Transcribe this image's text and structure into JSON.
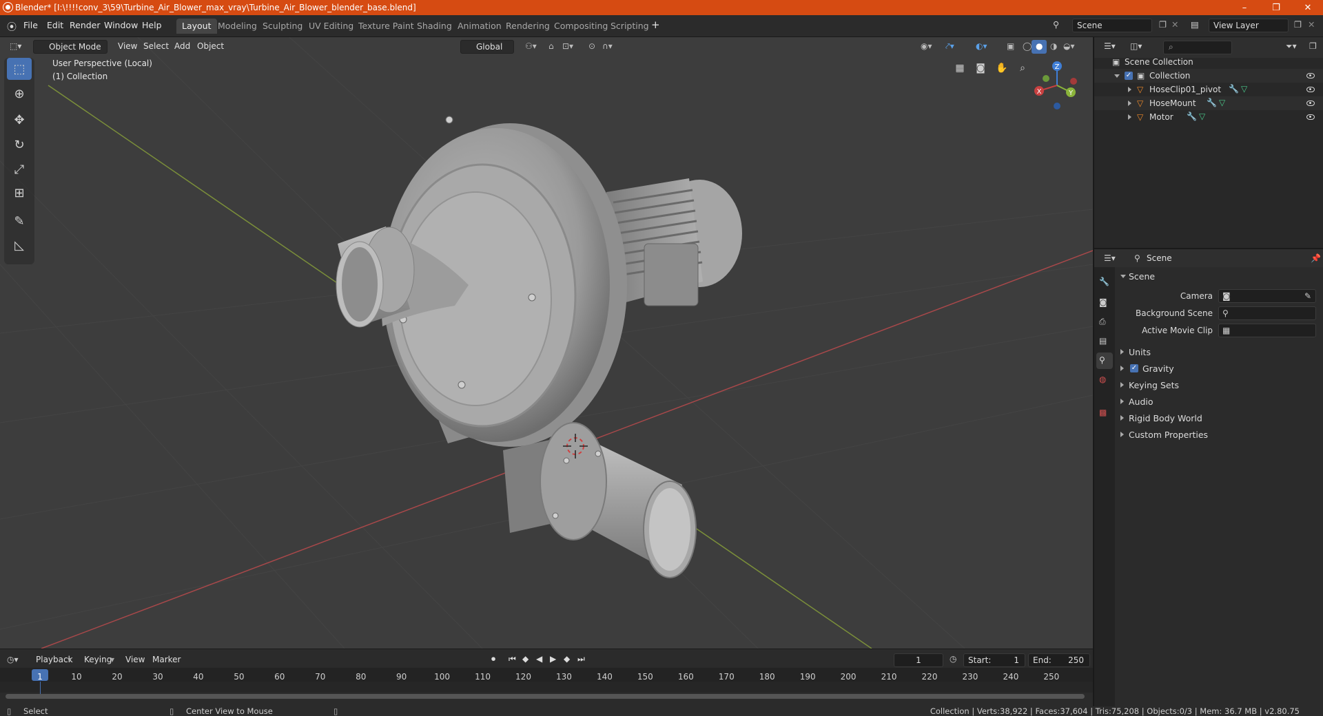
{
  "titlebar": {
    "title": "Blender* [I:\\!!!!conv_3\\59\\Turbine_Air_Blower_max_vray\\Turbine_Air_Blower_blender_base.blend]",
    "minimize": "–",
    "restore": "❐",
    "close": "✕"
  },
  "menu": {
    "file": "File",
    "edit": "Edit",
    "render": "Render",
    "window": "Window",
    "help": "Help"
  },
  "workspaces": [
    "Layout",
    "Modeling",
    "Sculpting",
    "UV Editing",
    "Texture Paint",
    "Shading",
    "Animation",
    "Rendering",
    "Compositing",
    "Scripting"
  ],
  "workspace_add": "+",
  "scene_selector": {
    "value": "Scene"
  },
  "view_layer_selector": {
    "value": "View Layer"
  },
  "viewport_header": {
    "mode": "Object Mode",
    "view": "View",
    "select": "Select",
    "add": "Add",
    "object": "Object",
    "orientation": "Global"
  },
  "viewport": {
    "perspective": "User Perspective (Local)",
    "collection": "(1) Collection",
    "gizmo": {
      "x": "X",
      "y": "Y",
      "z": "Z"
    }
  },
  "outliner": {
    "search_placeholder": "",
    "root": "Scene Collection",
    "collection": "Collection",
    "objects": [
      "HoseClip01_pivot",
      "HoseMount",
      "Motor"
    ]
  },
  "properties": {
    "header": "Scene",
    "panel_title": "Scene",
    "camera_label": "Camera",
    "background_scene_label": "Background Scene",
    "active_movie_clip_label": "Active Movie Clip",
    "panels": [
      "Units",
      "Gravity",
      "Keying Sets",
      "Audio",
      "Rigid Body World",
      "Custom Properties"
    ]
  },
  "timeline": {
    "playback": "Playback",
    "keying": "Keying",
    "view": "View",
    "marker": "Marker",
    "current_frame": "1",
    "start_label": "Start:",
    "start": "1",
    "end_label": "End:",
    "end": "250",
    "ruler": [
      "1",
      "10",
      "20",
      "30",
      "40",
      "50",
      "60",
      "70",
      "80",
      "90",
      "100",
      "110",
      "120",
      "130",
      "140",
      "150",
      "160",
      "170",
      "180",
      "190",
      "200",
      "210",
      "220",
      "230",
      "240",
      "250"
    ]
  },
  "statusbar": {
    "select": "Select",
    "center_view": "Center View to Mouse",
    "stats": "Collection | Verts:38,922 | Faces:37,604 | Tris:75,208 | Objects:0/3 | Mem: 36.7 MB | v2.80.75"
  },
  "colors": {
    "accent": "#4772b3",
    "title_bar": "#d64b12",
    "x_axis": "#c84040",
    "y_axis": "#8ab43a",
    "z_axis": "#3f7ed6"
  }
}
